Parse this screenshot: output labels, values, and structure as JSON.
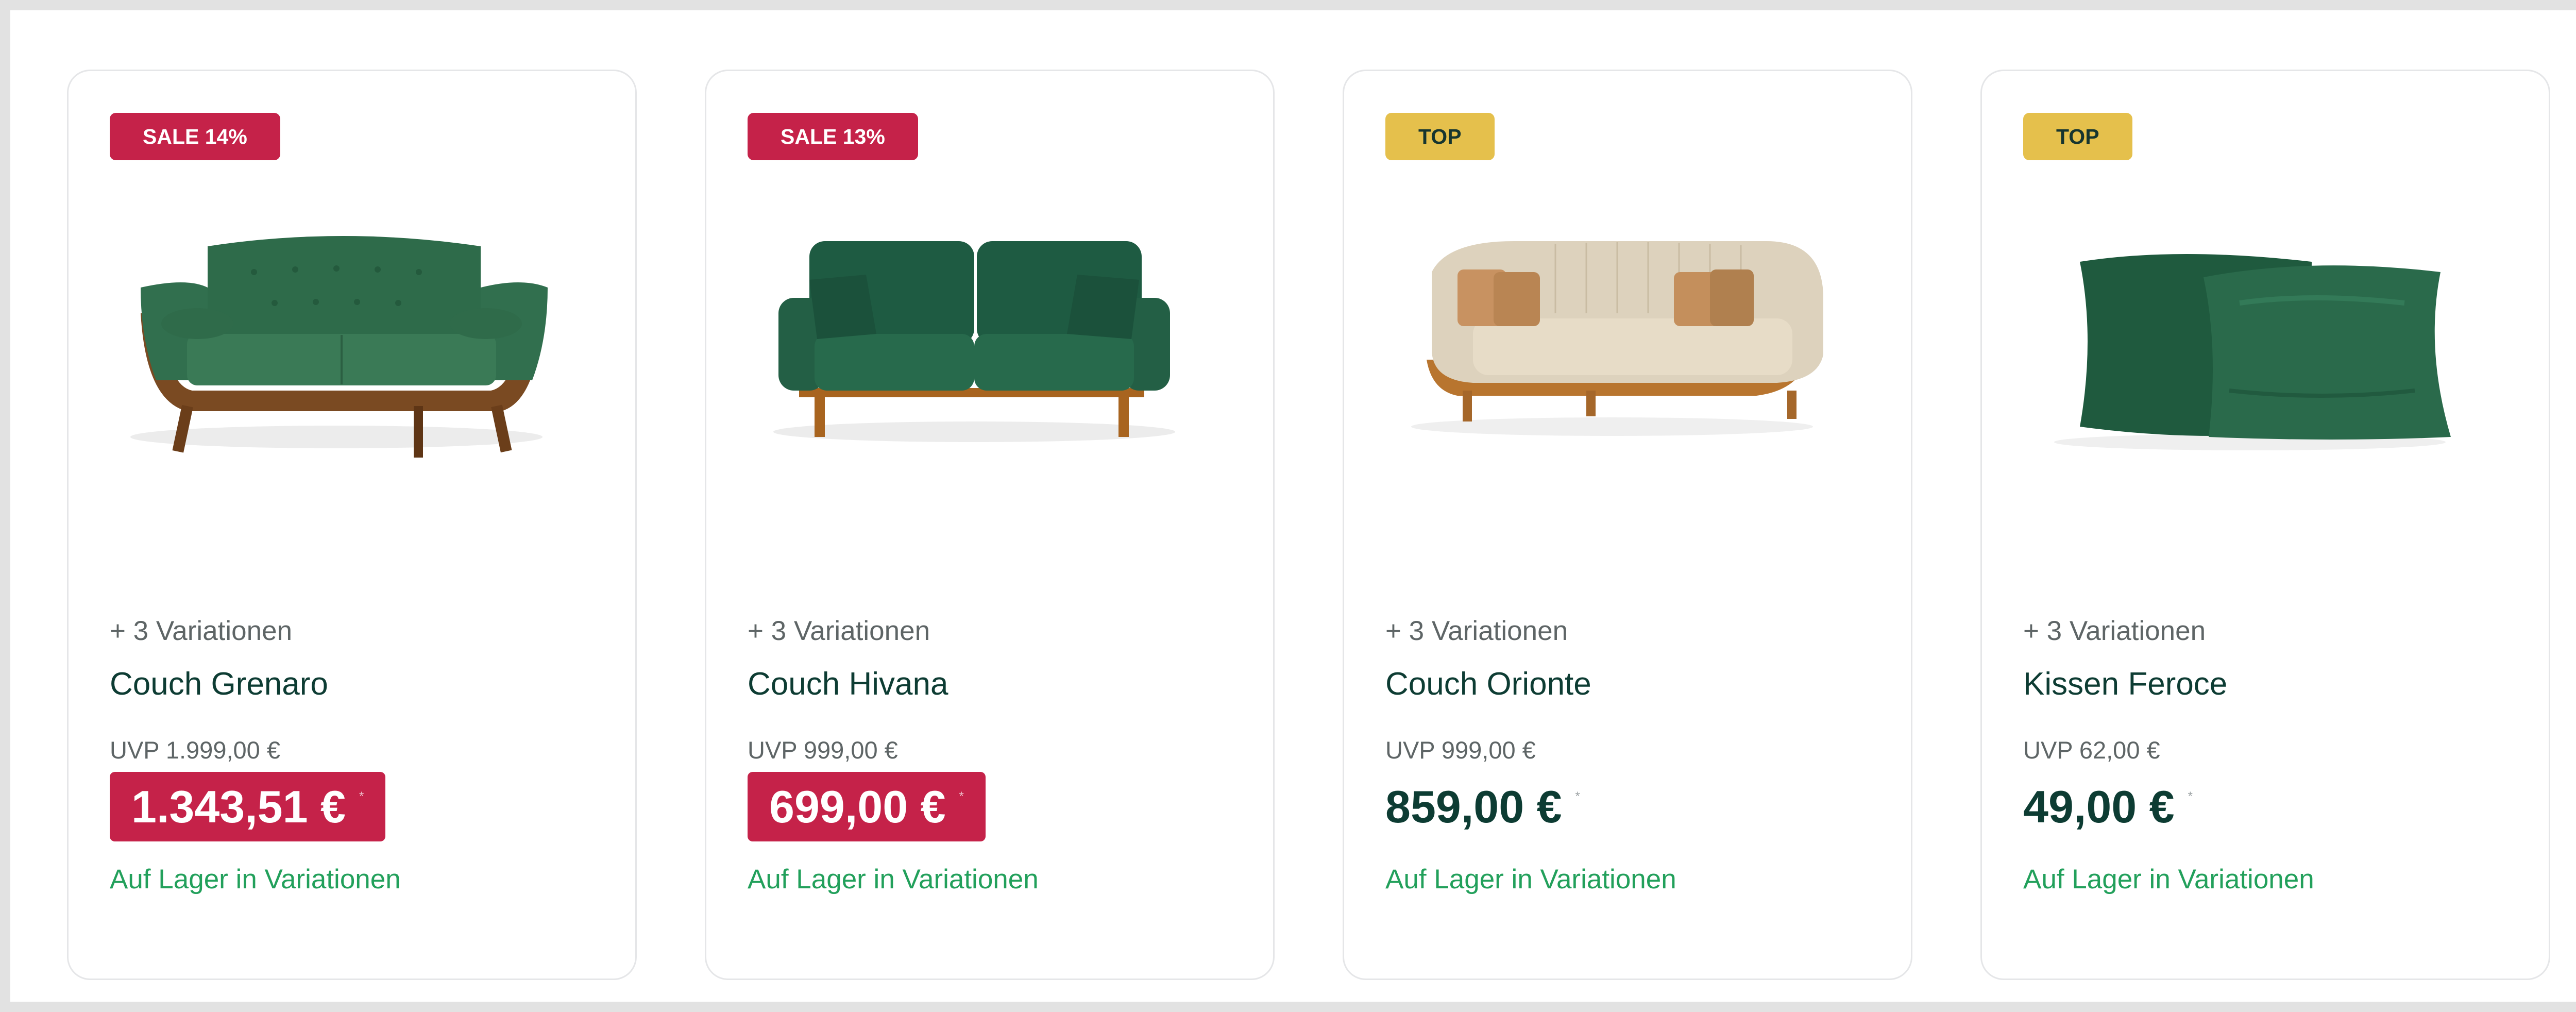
{
  "products": [
    {
      "badge": "SALE 14%",
      "variations": "+ 3 Variationen",
      "name": "Couch Grenaro",
      "uvp": "UVP 1.999,00 €",
      "price": "1.343,51 €",
      "asterisk": "*",
      "stock": "Auf Lager in Variationen"
    },
    {
      "badge": "SALE 13%",
      "variations": "+ 3 Variationen",
      "name": "Couch Hivana",
      "uvp": "UVP 999,00 €",
      "price": "699,00 €",
      "asterisk": "*",
      "stock": "Auf Lager in Variationen"
    },
    {
      "badge": "TOP",
      "variations": "+ 3 Variationen",
      "name": "Couch Orionte",
      "uvp": "UVP 999,00 €",
      "price": "859,00 €",
      "asterisk": "*",
      "stock": "Auf Lager in Variationen"
    },
    {
      "badge": "TOP",
      "variations": "+ 3 Variationen",
      "name": "Kissen Feroce",
      "uvp": "UVP 62,00 €",
      "price": "49,00 €",
      "asterisk": "*",
      "stock": "Auf Lager in Variationen"
    }
  ],
  "colors": {
    "sale_badge": "#c52249",
    "top_badge": "#e5c04c",
    "price_text": "#0d3c33",
    "stock_text": "#22a05b"
  }
}
